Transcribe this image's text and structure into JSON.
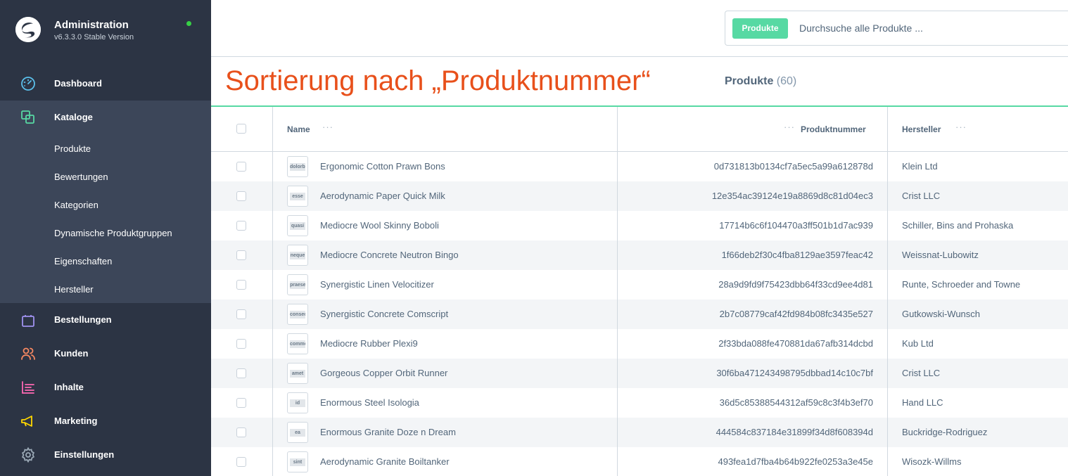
{
  "brand": {
    "title": "Administration",
    "version": "v6.3.3.0 Stable Version",
    "status_color": "#37d046"
  },
  "nav": {
    "dashboard": {
      "label": "Dashboard",
      "icon": "gauge-icon",
      "color": "#5bc0eb"
    },
    "catalogs": {
      "label": "Kataloge",
      "icon": "catalog-icon",
      "color": "#57d9a3"
    },
    "catalog_items": [
      {
        "label": "Produkte"
      },
      {
        "label": "Bewertungen"
      },
      {
        "label": "Kategorien"
      },
      {
        "label": "Dynamische Produktgruppen"
      },
      {
        "label": "Eigenschaften"
      },
      {
        "label": "Hersteller"
      }
    ],
    "orders": {
      "label": "Bestellungen",
      "icon": "shopping-bag-icon",
      "color": "#a092f0"
    },
    "customers": {
      "label": "Kunden",
      "icon": "customers-icon",
      "color": "#f88962"
    },
    "content": {
      "label": "Inhalte",
      "icon": "content-icon",
      "color": "#ff68b4"
    },
    "marketing": {
      "label": "Marketing",
      "icon": "megaphone-icon",
      "color": "#ffd700"
    },
    "settings": {
      "label": "Einstellungen",
      "icon": "gear-icon",
      "color": "#9aa8b5"
    }
  },
  "search": {
    "tag": "Produkte",
    "placeholder": "Durchsuche alle Produkte ..."
  },
  "annotation": "Sortierung nach „Produktnummer“",
  "page": {
    "title": "Produkte",
    "count": "(60)"
  },
  "grid": {
    "columns": {
      "name": "Name",
      "number": "Produktnummer",
      "manufacturer": "Hersteller"
    },
    "rows": [
      {
        "thumb": "dolorbus",
        "name": "Ergonomic Cotton Prawn Bons",
        "number": "0d731813b0134cf7a5ec5a99a612878d",
        "manufacturer": "Klein Ltd"
      },
      {
        "thumb": "esse",
        "name": "Aerodynamic Paper Quick Milk",
        "number": "12e354ac39124e19a8869d8c81d04ec3",
        "manufacturer": "Crist LLC"
      },
      {
        "thumb": "quasi",
        "name": "Mediocre Wool Skinny Boboli",
        "number": "17714b6c6f104470a3ff501b1d7ac939",
        "manufacturer": "Schiller, Bins and Prohaska"
      },
      {
        "thumb": "neque",
        "name": "Mediocre Concrete Neutron Bingo",
        "number": "1f66deb2f30c4fba8129ae3597feac42",
        "manufacturer": "Weissnat-Lubowitz"
      },
      {
        "thumb": "praesentium",
        "name": "Synergistic Linen Velocitizer",
        "number": "28a9d9fd9f75423dbb64f33cd9ee4d81",
        "manufacturer": "Runte, Schroeder and Towne"
      },
      {
        "thumb": "consectetur",
        "name": "Synergistic Concrete Comscript",
        "number": "2b7c08779caf42fd984b08fc3435e527",
        "manufacturer": "Gutkowski-Wunsch"
      },
      {
        "thumb": "commodi",
        "name": "Mediocre Rubber Plexi9",
        "number": "2f33bda088fe470881da67afb314dcbd",
        "manufacturer": "Kub Ltd"
      },
      {
        "thumb": "amet",
        "name": "Gorgeous Copper Orbit Runner",
        "number": "30f6ba471243498795dbbad14c10c7bf",
        "manufacturer": "Crist LLC"
      },
      {
        "thumb": "id",
        "name": "Enormous Steel Isologia",
        "number": "36d5c85388544312af59c8c3f4b3ef70",
        "manufacturer": "Hand LLC"
      },
      {
        "thumb": "ea",
        "name": "Enormous Granite Doze n Dream",
        "number": "444584c837184e31899f34d8f608394d",
        "manufacturer": "Buckridge-Rodriguez"
      },
      {
        "thumb": "sint",
        "name": "Aerodynamic Granite Boiltanker",
        "number": "493fea1d7fba4b64b922fe0253a3e45e",
        "manufacturer": "Wisozk-Willms"
      }
    ]
  }
}
